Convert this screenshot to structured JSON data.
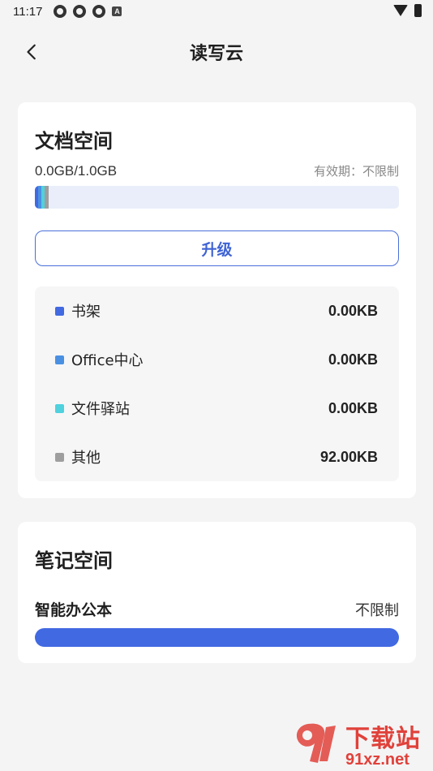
{
  "status_bar": {
    "time": "11:17",
    "notification_icons": [
      "app-icon",
      "app-icon",
      "app-icon",
      "a-icon"
    ],
    "a_label": "A"
  },
  "header": {
    "title": "读写云",
    "back_icon": "chevron-left-icon"
  },
  "doc_space": {
    "title": "文档空间",
    "usage": "0.0GB/1.0GB",
    "validity": "有效期：不限制",
    "progress_segments": [
      {
        "color": "#4169e1"
      },
      {
        "color": "#4a90e2"
      },
      {
        "color": "#4fd1de"
      },
      {
        "color": "#9e9e9e"
      }
    ],
    "upgrade_label": "升级",
    "items": [
      {
        "label": "书架",
        "value": "0.00KB",
        "color": "#4169e1"
      },
      {
        "label": "Office中心",
        "value": "0.00KB",
        "color": "#4a90e2"
      },
      {
        "label": "文件驿站",
        "value": "0.00KB",
        "color": "#4fd1de"
      },
      {
        "label": "其他",
        "value": "92.00KB",
        "color": "#9e9e9e"
      }
    ]
  },
  "note_space": {
    "title": "笔记空间",
    "item_label": "智能办公本",
    "item_limit": "不限制",
    "bar_color": "#4169e1"
  },
  "watermark": {
    "title": "下载站",
    "url": "91xz.net"
  },
  "colors": {
    "accent": "#4169e1",
    "background": "#f4f4f5",
    "watermark": "#e0413a"
  }
}
